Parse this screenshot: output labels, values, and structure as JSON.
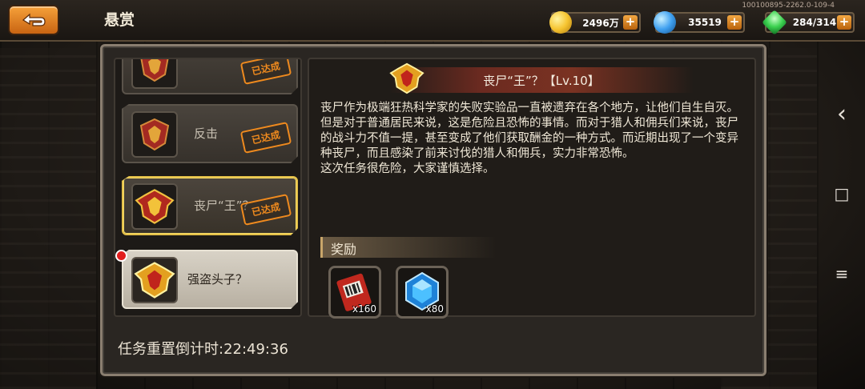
{
  "header": {
    "title": "悬赏",
    "version": "100100895-2262.0-109-4"
  },
  "resources": [
    {
      "name": "gold",
      "value": "2496万",
      "color": "#f6c430"
    },
    {
      "name": "diamond",
      "value": "35519",
      "color": "#3fa0f0"
    },
    {
      "name": "energy",
      "value": "284/314",
      "color": "#3cd250"
    }
  ],
  "quest_list": {
    "items": [
      {
        "label": "",
        "status": "已达成"
      },
      {
        "label": "反击",
        "status": "已达成"
      },
      {
        "label": "丧尸“王”？",
        "status": "已达成"
      },
      {
        "label": "强盗头子？",
        "status": ""
      }
    ]
  },
  "detail": {
    "title": "丧尸“王”？【Lv.10】",
    "description": "丧尸作为极端狂热科学家的失败实验品一直被遗弃在各个地方，让他们自生自灭。但是对于普通居民来说，这是危险且恐怖的事情。而对于猎人和佣兵们来说，丧尸的战斗力不值一提，甚至变成了他们获取酬金的一种方式。而近期出现了一个变异种丧尸，而且感染了前来讨伐的猎人和佣兵，实力非常恐怖。\n这次任务很危险，大家谨慎选择。",
    "reward_label": "奖励",
    "rewards": [
      {
        "name": "ticket",
        "qty": "x160"
      },
      {
        "name": "blue-gem",
        "qty": "x80"
      }
    ]
  },
  "timer": "任务重置倒计时:22:49:36",
  "system_nav": {
    "back": "‹",
    "home": "□",
    "menu": "≡"
  }
}
